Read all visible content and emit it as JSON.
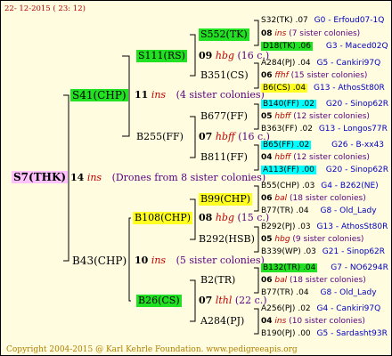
{
  "header_date": "22- 12-2015 ( 23: 12)",
  "footer": "Copyright 2004-2015 @ Karl Kehrle Foundation.   www.pedigreeapis.org",
  "root": {
    "name": "S7(THK)"
  },
  "gen1": {
    "num": "14",
    "ins": "ins",
    "note": "(Drones from 8 sister colonies)"
  },
  "upper": {
    "name": "S41(CHP)",
    "num": "11",
    "ins": "ins",
    "note": "(4 sister colonies)"
  },
  "lower": {
    "name": "B43(CHP)",
    "num": "10",
    "ins": "ins",
    "note": "(5 sister colonies)"
  },
  "nodes": {
    "s111": {
      "name": "S111(RS)",
      "num": "09",
      "ins": "hbg",
      "note": "(16 c.)"
    },
    "b351": {
      "name": "B351(CS)"
    },
    "s552": {
      "name": "S552(TK)"
    },
    "b255": {
      "name": "B255(FF)",
      "num": "07",
      "ins": "hbff",
      "note": "(16 c.)"
    },
    "b677": {
      "name": "B677(FF)"
    },
    "b811": {
      "name": "B811(FF)"
    },
    "b108": {
      "name": "B108(CHP)",
      "num": "08",
      "ins": "hbg",
      "note": "(15 c.)"
    },
    "b99": {
      "name": "B99(CHP)"
    },
    "b292": {
      "name": "B292(HSB)"
    },
    "b26": {
      "name": "B26(CS)",
      "num": "07",
      "ins": "lthl",
      "note": "(22 c.)"
    },
    "b2": {
      "name": "B2(TR)"
    },
    "a284": {
      "name": "A284(PJ)"
    }
  },
  "rows": [
    {
      "name": "S32(TK)",
      "val": ".07",
      "code": "G0 - Erfoud07-1Q"
    },
    {
      "num": "08",
      "ins": "ins",
      "note": "(7 sister colonies)"
    },
    {
      "name": "D18(TK)",
      "val": ".06",
      "code": "G3 - Maced02Q"
    },
    {
      "name": "A284(PJ)",
      "val": ".04",
      "code": "G5 - Cankiri97Q"
    },
    {
      "num": "06",
      "ins": "ffhf",
      "note": "(15 sister colonies)"
    },
    {
      "name": "B6(CS)",
      "val": ".04",
      "code": "G13 - AthosSt80R"
    },
    {
      "name": "B140(FF)",
      "val": ".02",
      "code": "G20 - Sinop62R"
    },
    {
      "num": "05",
      "ins": "hbff",
      "note": "(12 sister colonies)"
    },
    {
      "name": "B363(FF)",
      "val": ".02",
      "code": "G13 - Longos77R"
    },
    {
      "name": "B65(FF)",
      "val": ".02",
      "code": "G26 - B-xx43"
    },
    {
      "num": "04",
      "ins": "hbff",
      "note": "(12 sister colonies)"
    },
    {
      "name": "A113(FF)",
      "val": ".00",
      "code": "G20 - Sinop62R"
    },
    {
      "name": "B55(CHP)",
      "val": ".03",
      "code": "G4 - B262(NE)"
    },
    {
      "num": "06",
      "ins": "bal",
      "note": "(18 sister colonies)"
    },
    {
      "name": "B77(TR)",
      "val": ".04",
      "code": "G8 - Old_Lady"
    },
    {
      "name": "B292(PJ)",
      "val": ".03",
      "code": "G13 - AthosSt80R"
    },
    {
      "num": "05",
      "ins": "hbg",
      "note": "(9 sister colonies)"
    },
    {
      "name": "B339(WP)",
      "val": ".03",
      "code": "G21 - Sinop62R"
    },
    {
      "name": "B132(TR)",
      "val": ".04",
      "code": "G7 - NO6294R"
    },
    {
      "num": "06",
      "ins": "bal",
      "note": "(18 sister colonies)"
    },
    {
      "name": "B77(TR)",
      "val": ".04",
      "code": "G8 - Old_Lady"
    },
    {
      "name": "A256(PJ)",
      "val": ".02",
      "code": "G4 - Cankiri97Q"
    },
    {
      "num": "04",
      "ins": "ins",
      "note": "(10 sister colonies)"
    },
    {
      "name": "B190(PJ)",
      "val": ".00",
      "code": "G5 - Sardasht93R"
    }
  ],
  "colors": {
    "green": "#22e022",
    "yellow": "#ffff22",
    "cyan": "#00ffff",
    "pink": "#ffc2ff",
    "red": "#c00000",
    "blue": "#0000c0",
    "purple": "#5a0080"
  }
}
